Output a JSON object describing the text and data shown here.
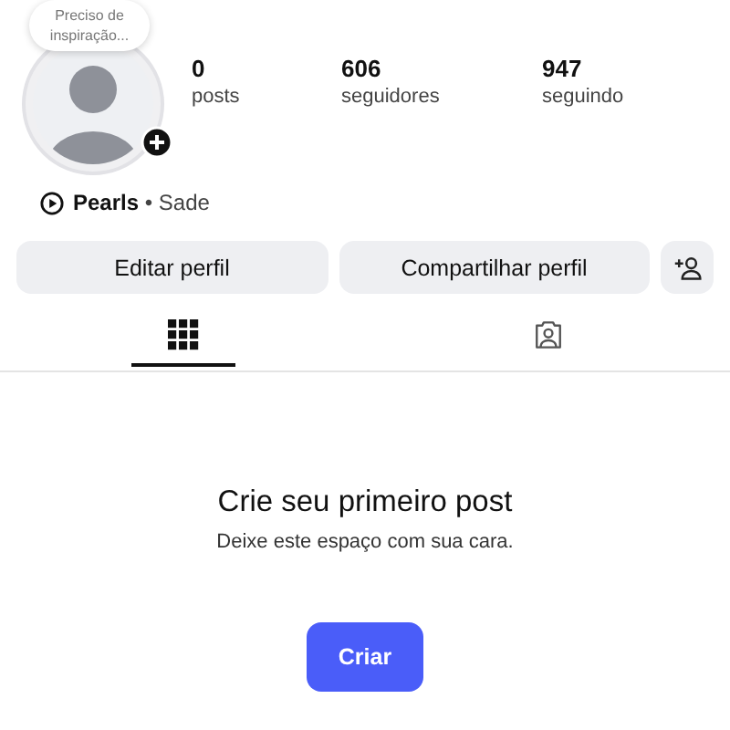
{
  "profile": {
    "note": "Preciso de inspiração...",
    "stats": [
      {
        "value": "0",
        "label": "posts"
      },
      {
        "value": "606",
        "label": "seguidores"
      },
      {
        "value": "947",
        "label": "seguindo"
      }
    ],
    "music": {
      "title": "Pearls",
      "separator": "•",
      "artist": "Sade"
    }
  },
  "buttons": [
    "Editar perfil",
    "Compartilhar perfil"
  ],
  "tabs": [
    {
      "kind": "grid",
      "selected": true
    },
    {
      "kind": "tagged",
      "selected": false
    }
  ],
  "empty_state": {
    "title": "Crie seu primeiro post",
    "subtitle": "Deixe este espaço com sua cara.",
    "button": "Criar"
  }
}
